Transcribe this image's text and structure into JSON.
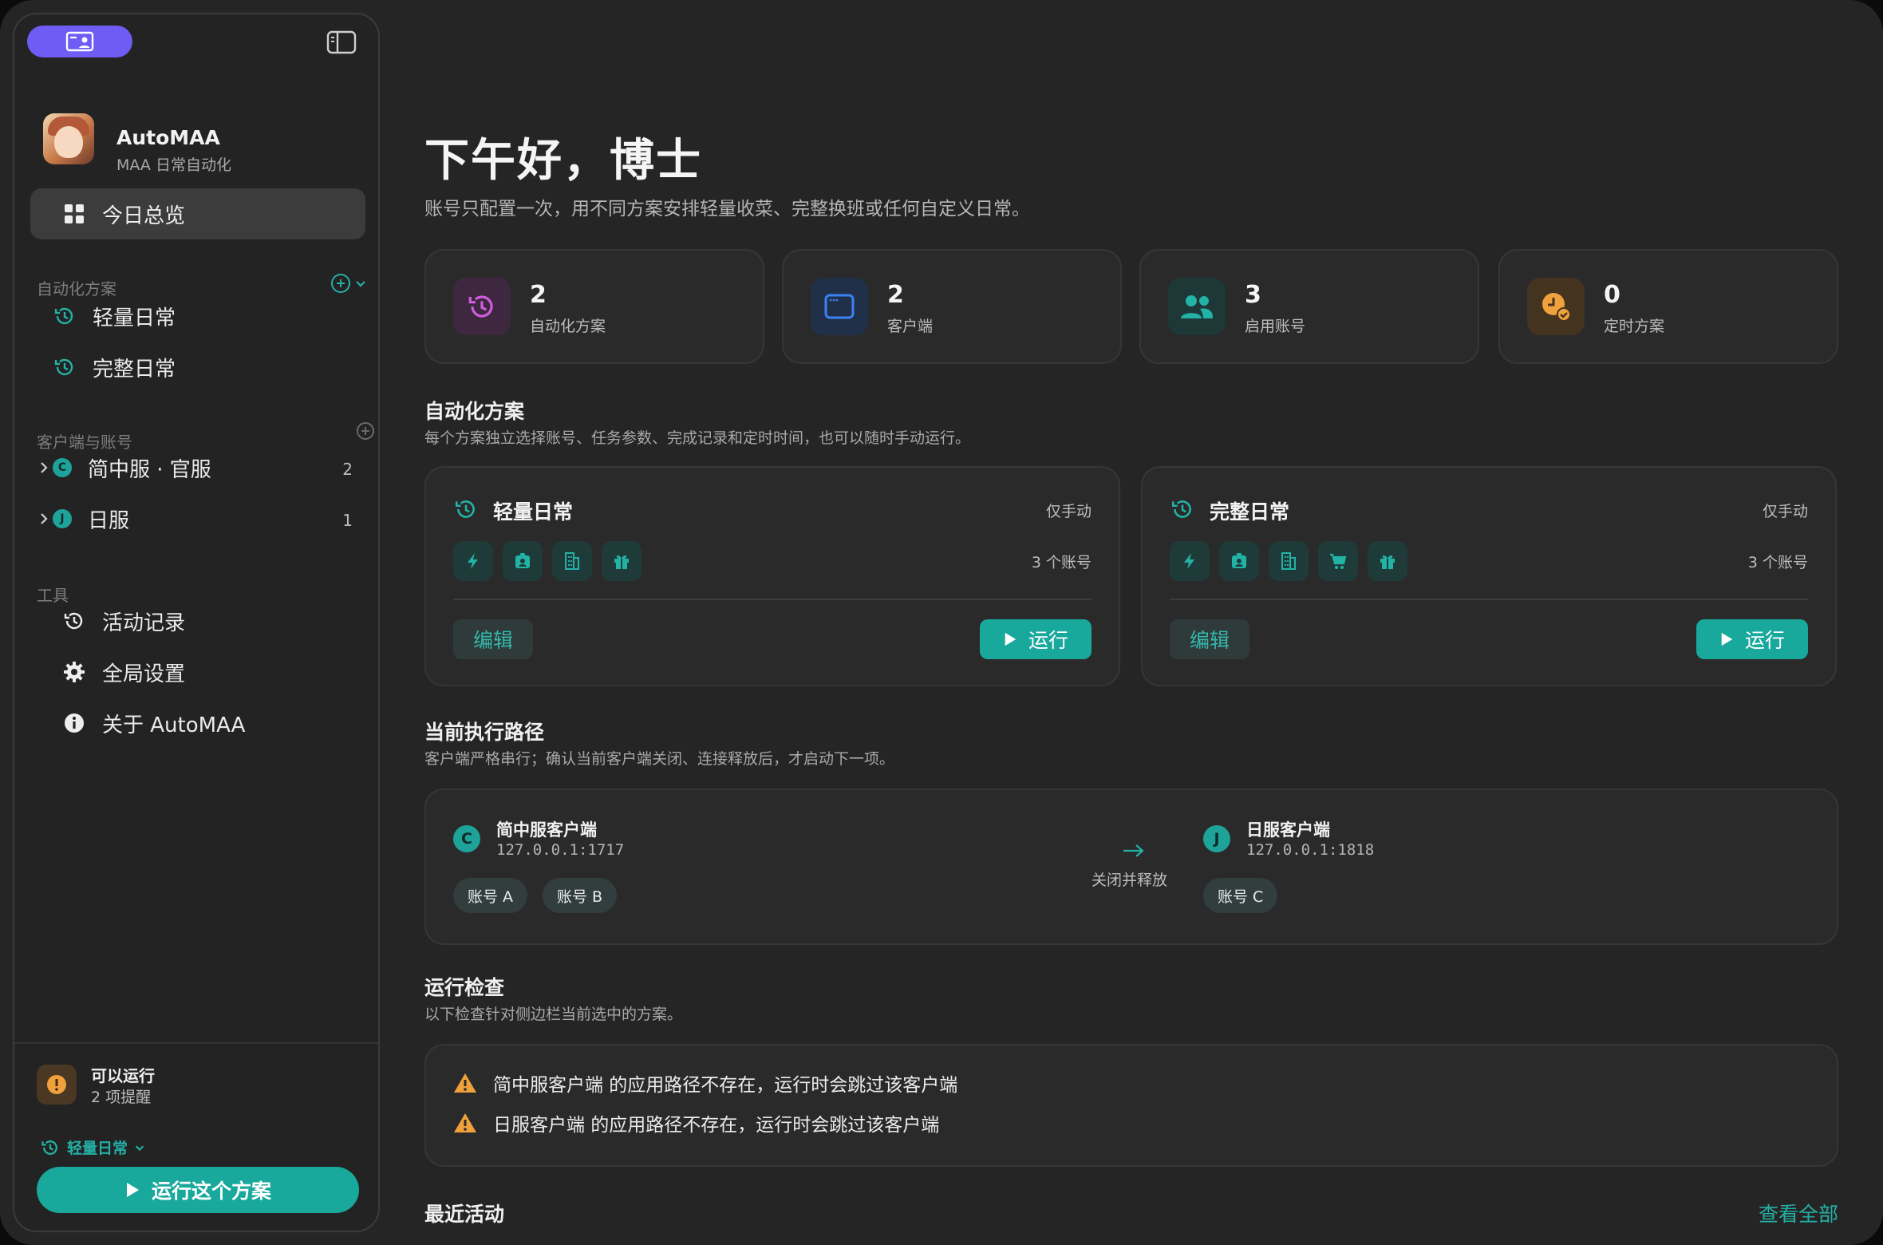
{
  "sidebar": {
    "app_name": "AutoMAA",
    "app_sub": "MAA 日常自动化",
    "overview": "今日总览",
    "sec_plans": "自动化方案",
    "plans": [
      "轻量日常",
      "完整日常"
    ],
    "sec_clients": "客户端与账号",
    "clients": [
      {
        "letter": "C",
        "name": "简中服 · 官服",
        "count": "2"
      },
      {
        "letter": "J",
        "name": "日服",
        "count": "1"
      }
    ],
    "sec_tools": "工具",
    "tools": [
      "活动记录",
      "全局设置",
      "关于 AutoMAA"
    ],
    "status_title": "可以运行",
    "status_sub": "2 项提醒",
    "selected_plan": "轻量日常",
    "run_label": "运行这个方案"
  },
  "main": {
    "greeting": "下午好，博士",
    "lead": "账号只配置一次，用不同方案安排轻量收菜、完整换班或任何自定义日常。",
    "stats": [
      {
        "num": "2",
        "label": "自动化方案",
        "color": "#d35be0"
      },
      {
        "num": "2",
        "label": "客户端",
        "color": "#3b82f6"
      },
      {
        "num": "3",
        "label": "启用账号",
        "color": "#22b3a6"
      },
      {
        "num": "0",
        "label": "定时方案",
        "color": "#f0a13c"
      }
    ],
    "plans_title": "自动化方案",
    "plans_desc": "每个方案独立选择账号、任务参数、完成记录和定时时间，也可以随时手动运行。",
    "plans": [
      {
        "name": "轻量日常",
        "mode": "仅手动",
        "accounts": "3 个账号",
        "edit": "编辑",
        "run": "运行"
      },
      {
        "name": "完整日常",
        "mode": "仅手动",
        "accounts": "3 个账号",
        "edit": "编辑",
        "run": "运行"
      }
    ],
    "route_title": "当前执行路径",
    "route_desc": "客户端严格串行；确认当前客户端关闭、连接释放后，才启动下一项。",
    "route": {
      "a": {
        "letter": "C",
        "name": "简中服客户端",
        "addr": "127.0.0.1:1717",
        "tags": [
          "账号 A",
          "账号 B"
        ]
      },
      "arrow_label": "关闭并释放",
      "b": {
        "letter": "J",
        "name": "日服客户端",
        "addr": "127.0.0.1:1818",
        "tags": [
          "账号 C"
        ]
      }
    },
    "check_title": "运行检查",
    "check_desc": "以下检查针对侧边栏当前选中的方案。",
    "checks": [
      "简中服客户端 的应用路径不存在，运行时会跳过该客户端",
      "日服客户端 的应用路径不存在，运行时会跳过该客户端"
    ],
    "recent_title": "最近活动",
    "view_all": "查看全部"
  }
}
